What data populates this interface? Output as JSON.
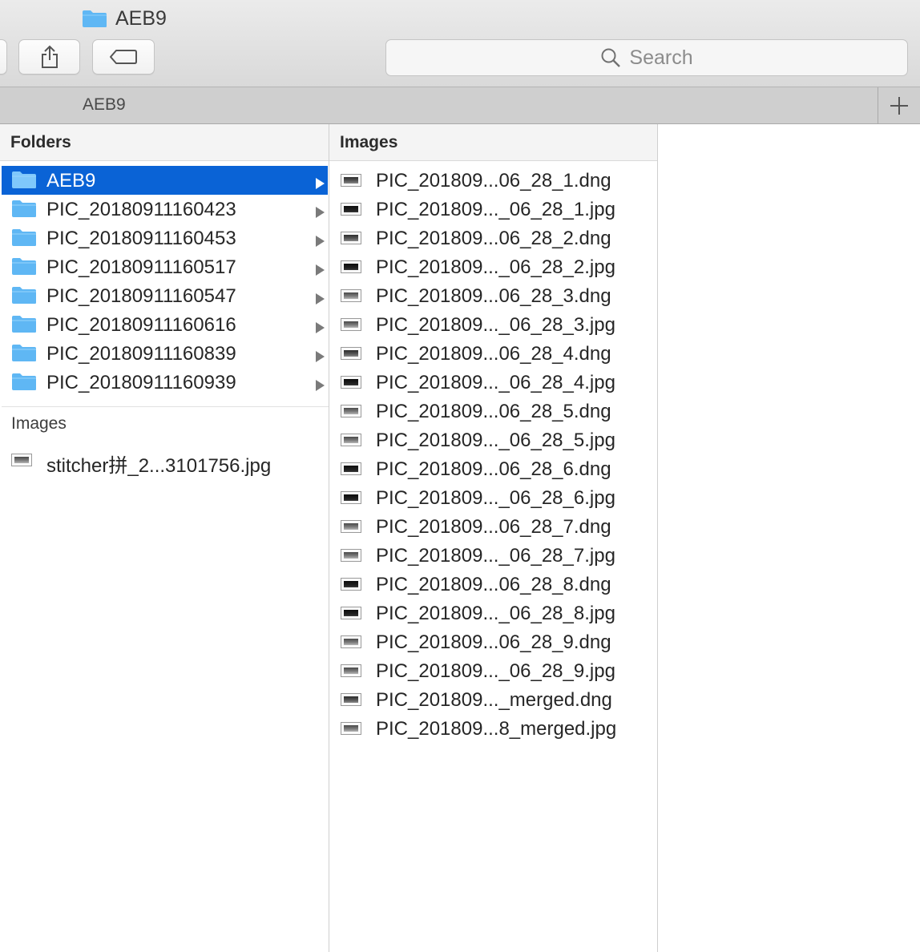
{
  "window": {
    "title": "AEB9"
  },
  "toolbar": {
    "search_placeholder": "Search"
  },
  "tabbar": {
    "tab_label": "AEB9"
  },
  "colors": {
    "selection": "#0a63d6",
    "folder": "#5fb7f4"
  },
  "column1": {
    "header": "Folders",
    "folders": [
      "AEB9",
      "PIC_20180911160423",
      "PIC_20180911160453",
      "PIC_20180911160517",
      "PIC_20180911160547",
      "PIC_20180911160616",
      "PIC_20180911160839",
      "PIC_20180911160939"
    ],
    "selected": "AEB9",
    "images_label": "Images",
    "images": [
      "stitcher拼_2...3101756.jpg"
    ]
  },
  "column2": {
    "header": "Images",
    "files": [
      "PIC_201809...06_28_1.dng",
      "PIC_201809..._06_28_1.jpg",
      "PIC_201809...06_28_2.dng",
      "PIC_201809..._06_28_2.jpg",
      "PIC_201809...06_28_3.dng",
      "PIC_201809..._06_28_3.jpg",
      "PIC_201809...06_28_4.dng",
      "PIC_201809..._06_28_4.jpg",
      "PIC_201809...06_28_5.dng",
      "PIC_201809..._06_28_5.jpg",
      "PIC_201809...06_28_6.dng",
      "PIC_201809..._06_28_6.jpg",
      "PIC_201809...06_28_7.dng",
      "PIC_201809..._06_28_7.jpg",
      "PIC_201809...06_28_8.dng",
      "PIC_201809..._06_28_8.jpg",
      "PIC_201809...06_28_9.dng",
      "PIC_201809..._06_28_9.jpg",
      "PIC_201809..._merged.dng",
      "PIC_201809...8_merged.jpg"
    ]
  }
}
